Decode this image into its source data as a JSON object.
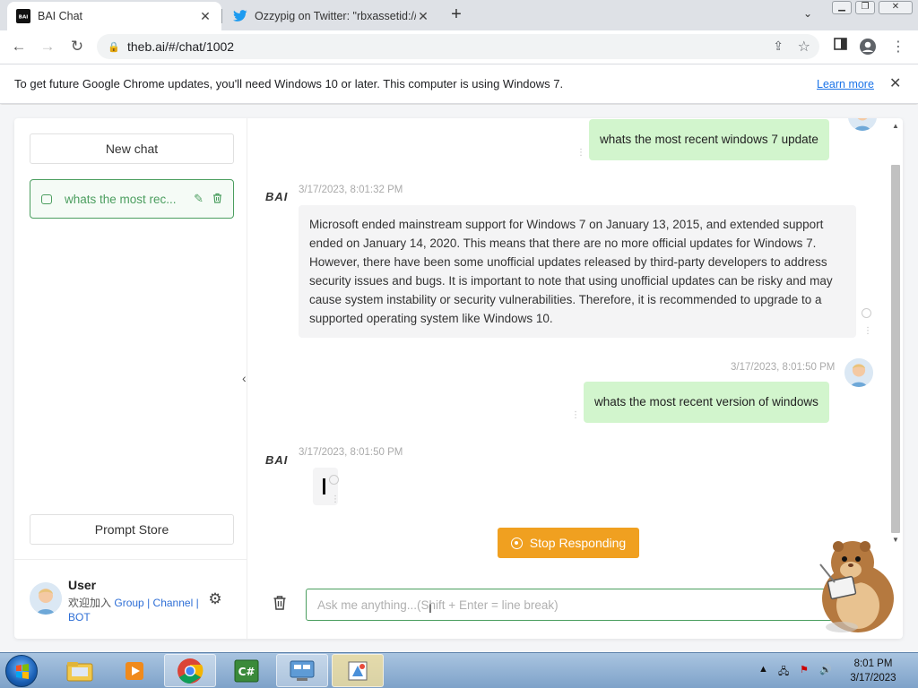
{
  "browser": {
    "tabs": [
      {
        "title": "BAI Chat",
        "active": true,
        "favicon": "bai-logo-icon"
      },
      {
        "title": "Ozzypig on Twitter: \"rbxassetid://",
        "active": false,
        "favicon": "twitter-bird-icon"
      }
    ],
    "url": "theb.ai/#/chat/1002",
    "window_controls": [
      "minimize",
      "restore",
      "close"
    ]
  },
  "infobar": {
    "message": "To get future Google Chrome updates, you'll need Windows 10 or later. This computer is using Windows 7.",
    "link": "Learn more"
  },
  "sidebar": {
    "new_chat": "New chat",
    "conversations": [
      {
        "title": "whats the most rec...",
        "active": true
      }
    ],
    "prompt_store": "Prompt Store",
    "user": {
      "name": "User",
      "join_prefix": "欢迎加入",
      "group": "Group",
      "channel": "Channel",
      "bot": "BOT",
      "sep": "|"
    }
  },
  "chat": {
    "bot_name": "BAI",
    "messages": [
      {
        "role": "user",
        "text": "whats the most recent windows 7 update"
      },
      {
        "role": "bot",
        "time": "3/17/2023, 8:01:32 PM",
        "text": "Microsoft ended mainstream support for Windows 7 on January 13, 2015, and extended support ended on January 14, 2020. This means that there are no more official updates for Windows 7. However, there have been some unofficial updates released by third-party developers to address security issues and bugs. It is important to note that using unofficial updates can be risky and may cause system instability or security vulnerabilities. Therefore, it is recommended to upgrade to a supported operating system like Windows 10."
      },
      {
        "role": "user",
        "time": "3/17/2023, 8:01:50 PM",
        "text": "whats the most recent version of windows"
      },
      {
        "role": "bot",
        "time": "3/17/2023, 8:01:50 PM",
        "text": ""
      }
    ],
    "stop_button": "Stop Responding",
    "input_placeholder": "Ask me anything...(Shift + Enter = line break)"
  },
  "taskbar": {
    "apps": [
      "windows-explorer",
      "media-player",
      "google-chrome",
      "csharp-ide",
      "control-panel",
      "paint"
    ],
    "time": "8:01 PM",
    "date": "3/17/2023"
  },
  "colors": {
    "accent_green": "#4b9e5f",
    "user_bubble": "#d2f5cd",
    "stop_orange": "#f0a020"
  }
}
